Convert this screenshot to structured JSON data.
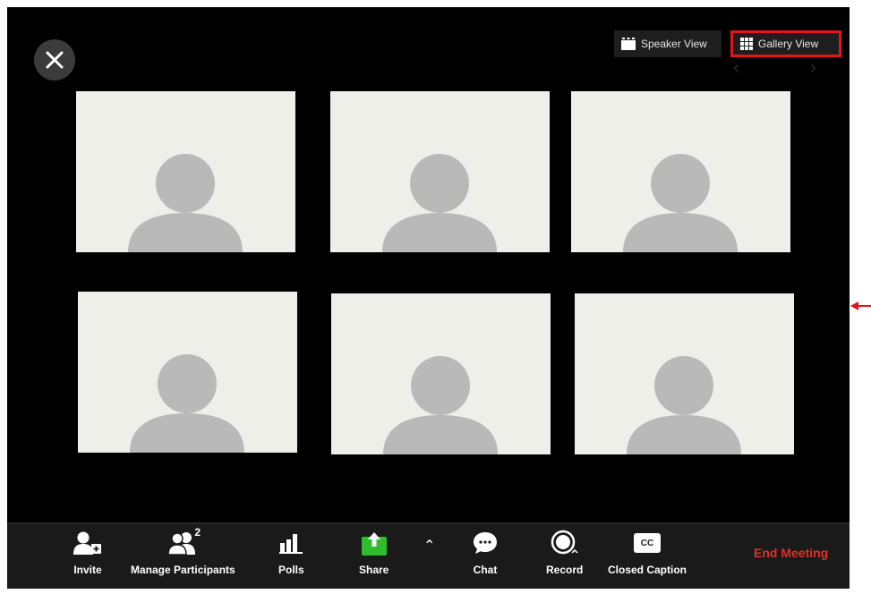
{
  "view_switcher": {
    "speaker_view_label": "Speaker View",
    "gallery_view_label": "Gallery View"
  },
  "participants_count": "2",
  "toolbar": {
    "invite_label": "Invite",
    "manage_participants_label": "Manage Participants",
    "polls_label": "Polls",
    "share_label": "Share",
    "chat_label": "Chat",
    "record_label": "Record",
    "closed_caption_label": "Closed Caption",
    "end_meeting_label": "End Meeting",
    "cc_icon_text": "CC"
  },
  "colors": {
    "highlight": "#e3151a",
    "share_green": "#2fbd2f",
    "end_meeting_red": "#e0302a",
    "tile_bg": "#efefea",
    "avatar_grey": "#b9b9b9"
  },
  "icons": {
    "close": "close-icon",
    "speaker_view": "speaker-view-icon",
    "gallery_view": "gallery-grid-icon",
    "invite": "add-person-icon",
    "participants": "people-icon",
    "polls": "bar-chart-icon",
    "share": "share-upload-icon",
    "more": "caret-up-icon",
    "chat": "chat-bubble-icon",
    "record": "record-icon",
    "closed_caption": "cc-icon"
  }
}
